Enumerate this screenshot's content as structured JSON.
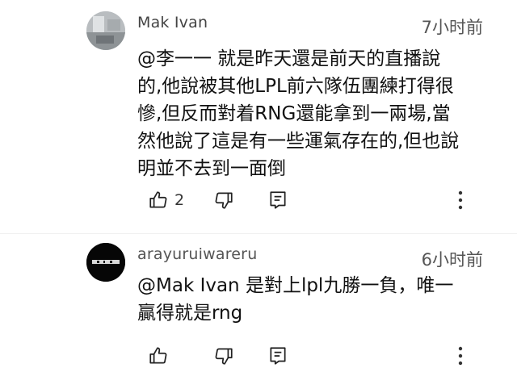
{
  "comments": [
    {
      "author": "Mak Ivan",
      "time": "7小时前",
      "text": "@李一一  就是昨天還是前天的直播說\n的,他說被其他LPL前六隊伍團練打得很\n慘,但反而對着RNG還能拿到一兩場,當\n然他說了這是有一些運氣存在的,但也說\n明並不去到一面倒",
      "like_count": "2",
      "avatar_icon": "profile-photo-avatar"
    },
    {
      "author": "arayuruiwareru",
      "time": "6小时前",
      "text": "@Mak Ivan  是對上lpl九勝一負，唯一\n贏得就是rng",
      "like_count": "",
      "avatar_icon": "dark-logo-avatar"
    }
  ],
  "icons": {
    "like": "thumbs-up-icon",
    "dislike": "thumbs-down-icon",
    "reply": "reply-icon",
    "more": "more-vertical-icon"
  },
  "colors": {
    "background": "#ffffff",
    "text": "#111111",
    "secondary": "#555555"
  }
}
